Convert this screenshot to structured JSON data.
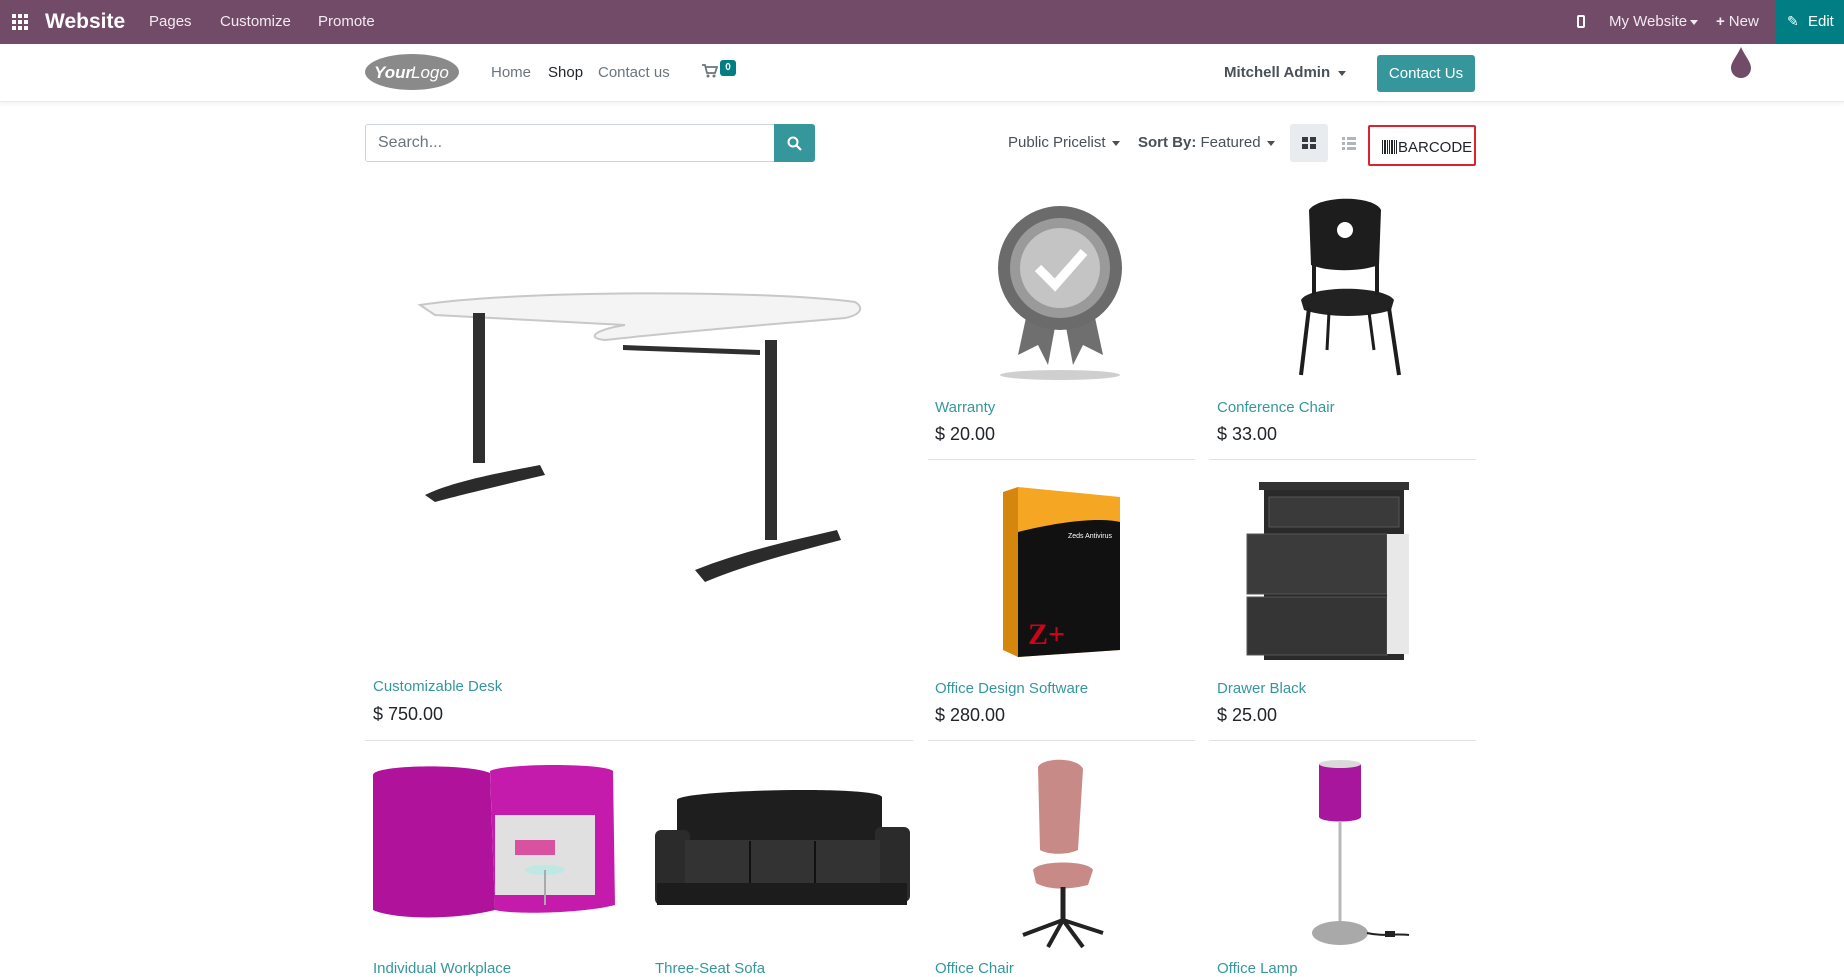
{
  "admin_bar": {
    "brand": "Website",
    "menu": [
      "Pages",
      "Customize",
      "Promote"
    ],
    "website_switcher": "My Website",
    "new_label": "New",
    "edit_label": "Edit",
    "color": "#714b67"
  },
  "header": {
    "logo_text": "YourLogo",
    "nav": [
      "Home",
      "Shop",
      "Contact us"
    ],
    "cart_count": "0",
    "user": "Mitchell Admin",
    "contact_button": "Contact Us",
    "accent": "#35979c"
  },
  "toolbar": {
    "search_placeholder": "Search...",
    "pricelist": "Public Pricelist",
    "sort_label": "Sort By:",
    "sort_value": "Featured",
    "barcode_label": "BARCODE"
  },
  "products": [
    {
      "name": "Customizable Desk",
      "price": "$ 750.00",
      "icon": "desk-image"
    },
    {
      "name": "Warranty",
      "price": "$ 20.00",
      "icon": "warranty-badge-image"
    },
    {
      "name": "Conference Chair",
      "price": "$ 33.00",
      "icon": "chair-image"
    },
    {
      "name": "Office Design Software",
      "price": "$ 280.00",
      "icon": "software-box-image"
    },
    {
      "name": "Drawer Black",
      "price": "$ 25.00",
      "icon": "drawer-image"
    },
    {
      "name": "Individual Workplace",
      "price": "",
      "icon": "booth-image"
    },
    {
      "name": "Three-Seat Sofa",
      "price": "",
      "icon": "sofa-image"
    },
    {
      "name": "Office Chair",
      "price": "",
      "icon": "office-chair-image"
    },
    {
      "name": "Office Lamp",
      "price": "",
      "icon": "lamp-image"
    }
  ]
}
